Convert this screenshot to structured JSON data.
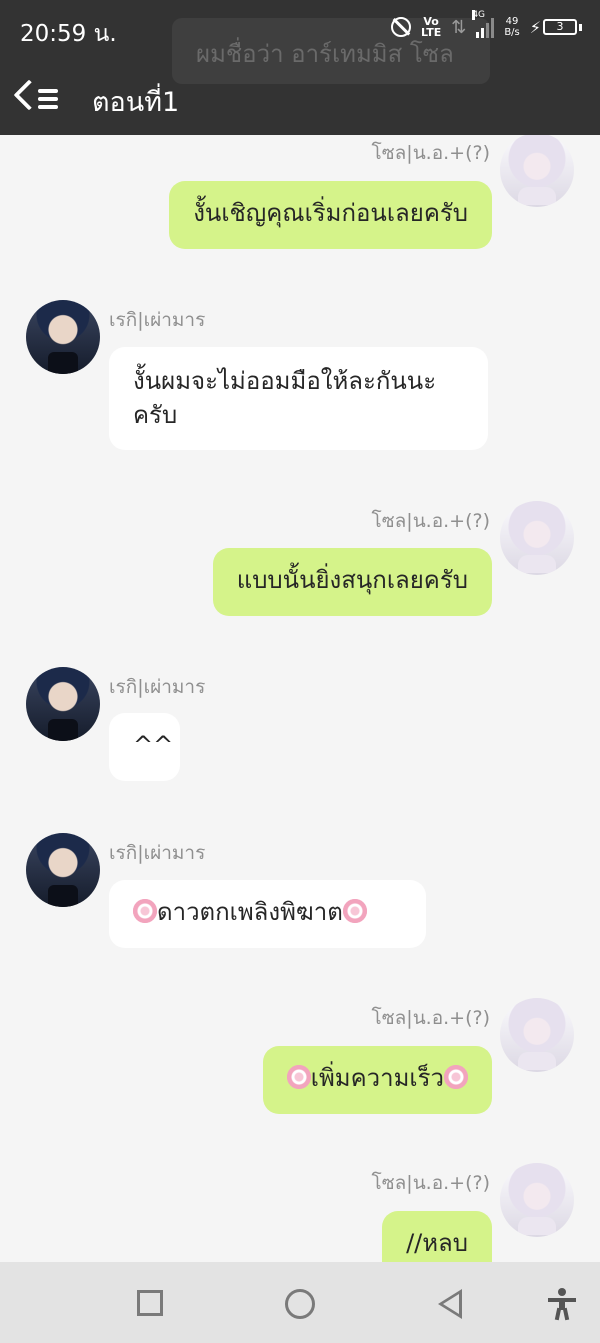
{
  "status_bar": {
    "time": "20:59 น.",
    "network_top": "Vo",
    "network_bottom": "LTE",
    "signal_label": "4G",
    "speed_value": "49",
    "speed_unit": "B/s",
    "battery": "3"
  },
  "header": {
    "title": "ตอนที่1",
    "partially_hidden_text": "ผมชื่อว่า อาร์เทมมิส โซล"
  },
  "messages": [
    {
      "side": "right",
      "sender": "โซล|น.อ.+(?)",
      "text": "งั้นเชิญคุณเริ่มก่อนเลยครับ"
    },
    {
      "side": "left",
      "sender": "เรกิ|เผ่ามาร",
      "text": "งั้นผมจะไม่ออมมือให้ละกันนะครับ"
    },
    {
      "side": "right",
      "sender": "โซล|น.อ.+(?)",
      "text": "แบบนั้นยิ่งสนุกเลยครับ"
    },
    {
      "side": "left",
      "sender": "เรกิ|เผ่ามาร",
      "text": "^^"
    },
    {
      "side": "left",
      "sender": "เรกิ|เผ่ามาร",
      "text": "ดาวตกเพลิงพิฆาต"
    },
    {
      "side": "right",
      "sender": "โซล|น.อ.+(?)",
      "text": "เพิ่มความเร็ว"
    },
    {
      "side": "right",
      "sender": "โซล|น.อ.+(?)",
      "text": "//หลบ"
    }
  ],
  "colors": {
    "header_bg": "#333333",
    "my_bubble": "#d5f38a",
    "their_bubble": "#ffffff",
    "page_bg": "#f5f5f5",
    "nav_bg": "#e3e3e3"
  },
  "icons": {
    "back": "chevron-left-icon",
    "menu": "list-icon",
    "flower": "sakura-flower-icon",
    "nav_recent": "square-icon",
    "nav_home": "circle-icon",
    "nav_back": "triangle-back-icon",
    "accessibility": "accessibility-icon"
  }
}
